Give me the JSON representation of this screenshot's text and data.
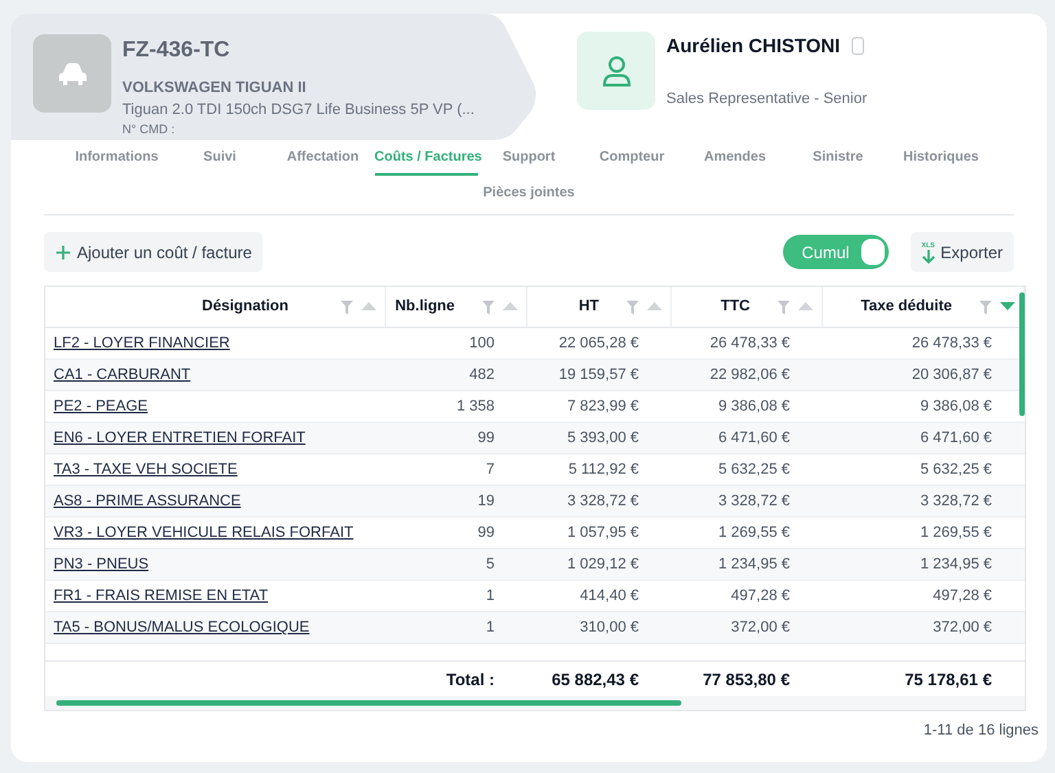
{
  "vehicle": {
    "plate": "FZ-436-TC",
    "model": "VOLKSWAGEN TIGUAN II",
    "version": "Tiguan 2.0 TDI 150ch DSG7 Life Business 5P VP (...",
    "order_label": "N° CMD :"
  },
  "driver": {
    "name": "Aurélien CHISTONI",
    "role": "Sales Representative - Senior"
  },
  "tabs": [
    {
      "label": "Informations",
      "selected": false
    },
    {
      "label": "Suivi",
      "selected": false
    },
    {
      "label": "Affectation",
      "selected": false
    },
    {
      "label": "Coûts / Factures",
      "selected": true
    },
    {
      "label": "Support",
      "selected": false
    },
    {
      "label": "Compteur",
      "selected": false
    },
    {
      "label": "Amendes",
      "selected": false
    },
    {
      "label": "Sinistre",
      "selected": false
    },
    {
      "label": "Historiques",
      "selected": false
    },
    {
      "label": "Pièces jointes",
      "selected": false
    }
  ],
  "toolbar": {
    "add_button": "Ajouter un coût / facture",
    "cumul": {
      "label": "Cumul",
      "on": true
    },
    "export_button": "Exporter",
    "export_badge": "XLS"
  },
  "table": {
    "columns": [
      {
        "label": "Désignation",
        "sorted": false
      },
      {
        "label": "Nb.ligne",
        "sorted": false
      },
      {
        "label": "HT",
        "sorted": false
      },
      {
        "label": "TTC",
        "sorted": false
      },
      {
        "label": "Taxe déduite",
        "sorted": true
      }
    ],
    "rows": [
      [
        "LF2 - LOYER FINANCIER",
        "100",
        "22 065,28 €",
        "26 478,33 €",
        "26 478,33 €"
      ],
      [
        "CA1 - CARBURANT",
        "482",
        "19 159,57 €",
        "22 982,06 €",
        "20 306,87 €"
      ],
      [
        "PE2 - PEAGE",
        "1 358",
        "7 823,99 €",
        "9 386,08 €",
        "9 386,08 €"
      ],
      [
        "EN6 - LOYER ENTRETIEN FORFAIT",
        "99",
        "5 393,00 €",
        "6 471,60 €",
        "6 471,60 €"
      ],
      [
        "TA3 - TAXE VEH SOCIETE",
        "7",
        "5 112,92 €",
        "5 632,25 €",
        "5 632,25 €"
      ],
      [
        "AS8 - PRIME ASSURANCE",
        "19",
        "3 328,72 €",
        "3 328,72 €",
        "3 328,72 €"
      ],
      [
        "VR3 - LOYER VEHICULE RELAIS FORFAIT",
        "99",
        "1 057,95 €",
        "1 269,55 €",
        "1 269,55 €"
      ],
      [
        "PN3 - PNEUS",
        "5",
        "1 029,12 €",
        "1 234,95 €",
        "1 234,95 €"
      ],
      [
        "FR1 - FRAIS REMISE EN ETAT",
        "1",
        "414,40 €",
        "497,28 €",
        "497,28 €"
      ],
      [
        "TA5 - BONUS/MALUS ECOLOGIQUE",
        "1",
        "310,00 €",
        "372,00 €",
        "372,00 €"
      ]
    ],
    "total": [
      "Total :",
      "65 882,43 €",
      "77 853,80 €",
      "75 178,61 €"
    ]
  },
  "pagination": "1-11 de 16 lignes"
}
